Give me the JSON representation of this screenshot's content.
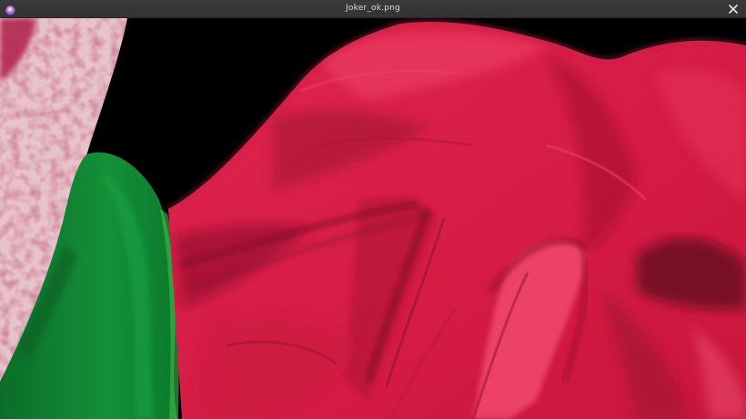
{
  "window": {
    "title": "Joker_ok.png",
    "app_icon": "app-icon",
    "close_icon": "close-icon"
  },
  "image": {
    "background_color": "#000000",
    "colors": {
      "red_cloth": "#d81f48",
      "red_dark": "#8a0f2a",
      "green_sleeve": "#0f8a34",
      "pink_stripe": "#e9c7cf"
    }
  }
}
